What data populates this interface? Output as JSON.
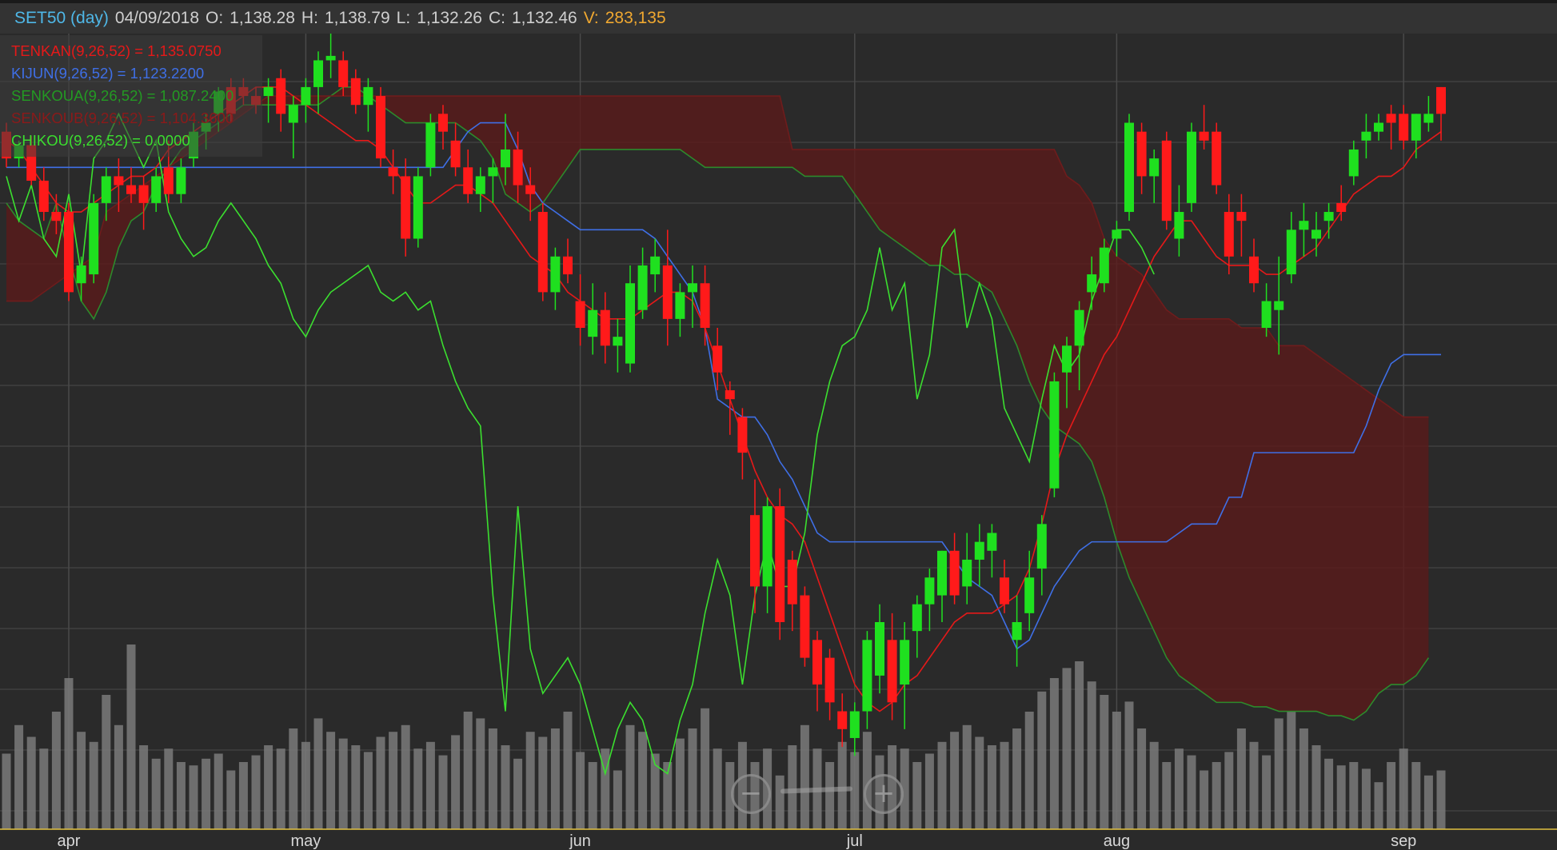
{
  "header": {
    "symbol": "SET50 (day)",
    "date": "04/09/2018",
    "open_label": "O:",
    "open": "1,138.28",
    "high_label": "H:",
    "high": "1,138.79",
    "low_label": "L:",
    "low": "1,132.26",
    "close_label": "C:",
    "close": "1,132.46",
    "volume_label": "V:",
    "volume": "283,135"
  },
  "legend": [
    {
      "text": "TENKAN(9,26,52) = 1,135.0750",
      "color": "#e51919"
    },
    {
      "text": "KIJUN(9,26,52) = 1,123.2200",
      "color": "#3f6fe6"
    },
    {
      "text": "SENKOUA(9,26,52) = 1,087.2400",
      "color": "#239a23"
    },
    {
      "text": "SENKOUB(9,26,52) = 1,104.3600",
      "color": "#8b1a1a"
    },
    {
      "text": "CHIKOU(9,26,52) = 0.0000",
      "color": "#3bdf2f"
    }
  ],
  "zoom": {
    "out_icon": "−",
    "in_icon": "+"
  },
  "colors": {
    "background": "#2a2a2a",
    "grid": "#4a4a4a",
    "up": "#1fe01f",
    "down": "#ff1a1a",
    "volume": "#7a7a7a",
    "time_axis": "#e0c040",
    "cloud_bull": "#2e6b2e",
    "cloud_bear": "#5a1a1a"
  },
  "chart_data": {
    "type": "candlestick_ichimoku",
    "x_labels": [
      {
        "label": "apr",
        "index": 5
      },
      {
        "label": "may",
        "index": 24
      },
      {
        "label": "jun",
        "index": 46
      },
      {
        "label": "jul",
        "index": 68
      },
      {
        "label": "aug",
        "index": 89
      },
      {
        "label": "sep",
        "index": 112
      }
    ],
    "candles": [
      [
        1128,
        1130,
        1120,
        1122
      ],
      [
        1122,
        1126,
        1120,
        1125
      ],
      [
        1125,
        1127,
        1116,
        1117
      ],
      [
        1117,
        1120,
        1108,
        1110
      ],
      [
        1110,
        1114,
        1105,
        1108
      ],
      [
        1110,
        1112,
        1090,
        1092
      ],
      [
        1094,
        1100,
        1090,
        1098
      ],
      [
        1096,
        1114,
        1094,
        1112
      ],
      [
        1112,
        1120,
        1108,
        1118
      ],
      [
        1118,
        1122,
        1110,
        1116
      ],
      [
        1116,
        1120,
        1112,
        1114
      ],
      [
        1116,
        1118,
        1106,
        1112
      ],
      [
        1112,
        1120,
        1110,
        1118
      ],
      [
        1120,
        1126,
        1112,
        1114
      ],
      [
        1114,
        1122,
        1112,
        1120
      ],
      [
        1122,
        1130,
        1120,
        1128
      ],
      [
        1128,
        1132,
        1124,
        1130
      ],
      [
        1132,
        1138,
        1128,
        1137
      ],
      [
        1138,
        1140,
        1130,
        1132
      ],
      [
        1138,
        1140,
        1134,
        1136
      ],
      [
        1136,
        1138,
        1132,
        1134
      ],
      [
        1136,
        1140,
        1130,
        1138
      ],
      [
        1140,
        1142,
        1128,
        1132
      ],
      [
        1130,
        1136,
        1122,
        1134
      ],
      [
        1134,
        1140,
        1130,
        1138
      ],
      [
        1138,
        1146,
        1132,
        1144
      ],
      [
        1144,
        1150,
        1140,
        1145
      ],
      [
        1144,
        1146,
        1136,
        1138
      ],
      [
        1140,
        1142,
        1132,
        1134
      ],
      [
        1134,
        1140,
        1128,
        1138
      ],
      [
        1136,
        1138,
        1120,
        1122
      ],
      [
        1120,
        1124,
        1114,
        1118
      ],
      [
        1118,
        1122,
        1100,
        1104
      ],
      [
        1104,
        1120,
        1102,
        1118
      ],
      [
        1120,
        1132,
        1118,
        1130
      ],
      [
        1132,
        1134,
        1124,
        1128
      ],
      [
        1126,
        1130,
        1118,
        1120
      ],
      [
        1120,
        1124,
        1112,
        1114
      ],
      [
        1114,
        1120,
        1110,
        1118
      ],
      [
        1118,
        1122,
        1112,
        1120
      ],
      [
        1120,
        1132,
        1116,
        1124
      ],
      [
        1124,
        1128,
        1112,
        1116
      ],
      [
        1116,
        1120,
        1108,
        1114
      ],
      [
        1110,
        1112,
        1090,
        1092
      ],
      [
        1092,
        1102,
        1088,
        1100
      ],
      [
        1100,
        1104,
        1094,
        1096
      ],
      [
        1090,
        1096,
        1080,
        1084
      ],
      [
        1082,
        1094,
        1078,
        1088
      ],
      [
        1088,
        1092,
        1076,
        1080
      ],
      [
        1080,
        1086,
        1074,
        1082
      ],
      [
        1076,
        1098,
        1074,
        1094
      ],
      [
        1088,
        1102,
        1086,
        1098
      ],
      [
        1096,
        1104,
        1092,
        1100
      ],
      [
        1098,
        1106,
        1080,
        1086
      ],
      [
        1086,
        1094,
        1082,
        1092
      ],
      [
        1092,
        1098,
        1084,
        1094
      ],
      [
        1094,
        1098,
        1080,
        1084
      ],
      [
        1080,
        1084,
        1070,
        1074
      ],
      [
        1070,
        1072,
        1060,
        1068
      ],
      [
        1064,
        1066,
        1050,
        1056
      ],
      [
        1042,
        1050,
        1020,
        1026
      ],
      [
        1026,
        1046,
        1020,
        1044
      ],
      [
        1044,
        1048,
        1014,
        1018
      ],
      [
        1032,
        1034,
        1016,
        1022
      ],
      [
        1024,
        1026,
        1008,
        1010
      ],
      [
        1014,
        1016,
        998,
        1004
      ],
      [
        1010,
        1012,
        996,
        1000
      ],
      [
        998,
        1002,
        990,
        994
      ],
      [
        992,
        1000,
        988,
        998
      ],
      [
        998,
        1016,
        994,
        1014
      ],
      [
        1006,
        1022,
        1002,
        1018
      ],
      [
        1014,
        1020,
        996,
        1000
      ],
      [
        1004,
        1018,
        994,
        1014
      ],
      [
        1016,
        1024,
        1010,
        1022
      ],
      [
        1022,
        1030,
        1016,
        1028
      ],
      [
        1024,
        1034,
        1018,
        1034
      ],
      [
        1034,
        1038,
        1022,
        1024
      ],
      [
        1026,
        1038,
        1022,
        1032
      ],
      [
        1032,
        1040,
        1026,
        1036
      ],
      [
        1034,
        1040,
        1028,
        1038
      ],
      [
        1028,
        1032,
        1020,
        1022
      ],
      [
        1014,
        1024,
        1008,
        1018
      ],
      [
        1020,
        1034,
        1016,
        1028
      ],
      [
        1030,
        1042,
        1024,
        1040
      ],
      [
        1048,
        1074,
        1046,
        1072
      ],
      [
        1074,
        1082,
        1066,
        1080
      ],
      [
        1080,
        1090,
        1070,
        1088
      ],
      [
        1092,
        1100,
        1088,
        1096
      ],
      [
        1094,
        1104,
        1092,
        1102
      ],
      [
        1104,
        1108,
        1100,
        1106
      ],
      [
        1110,
        1132,
        1108,
        1130
      ],
      [
        1128,
        1130,
        1114,
        1118
      ],
      [
        1118,
        1124,
        1112,
        1122
      ],
      [
        1126,
        1128,
        1106,
        1108
      ],
      [
        1104,
        1116,
        1100,
        1110
      ],
      [
        1112,
        1130,
        1110,
        1128
      ],
      [
        1128,
        1134,
        1124,
        1126
      ],
      [
        1128,
        1130,
        1114,
        1116
      ],
      [
        1110,
        1114,
        1096,
        1100
      ],
      [
        1110,
        1114,
        1100,
        1108
      ],
      [
        1100,
        1104,
        1092,
        1094
      ],
      [
        1084,
        1094,
        1082,
        1090
      ],
      [
        1088,
        1100,
        1078,
        1090
      ],
      [
        1096,
        1110,
        1094,
        1106
      ],
      [
        1106,
        1112,
        1100,
        1108
      ],
      [
        1104,
        1110,
        1100,
        1106
      ],
      [
        1108,
        1112,
        1104,
        1110
      ],
      [
        1112,
        1116,
        1108,
        1110
      ],
      [
        1118,
        1126,
        1116,
        1124
      ],
      [
        1126,
        1132,
        1122,
        1128
      ],
      [
        1128,
        1132,
        1126,
        1130
      ],
      [
        1132,
        1134,
        1124,
        1130
      ],
      [
        1132,
        1134,
        1124,
        1126
      ],
      [
        1126,
        1132,
        1122,
        1132
      ],
      [
        1130,
        1136,
        1128,
        1132
      ],
      [
        1138,
        1138,
        1126,
        1132
      ]
    ],
    "volume": [],
    "tenkan": [
      1126,
      1124,
      1120,
      1116,
      1112,
      1110,
      1110,
      1112,
      1114,
      1116,
      1118,
      1118,
      1120,
      1124,
      1126,
      1128,
      1130,
      1132,
      1134,
      1136,
      1138,
      1138,
      1138,
      1136,
      1134,
      1132,
      1130,
      1128,
      1126,
      1126,
      1124,
      1120,
      1116,
      1112,
      1112,
      1114,
      1116,
      1116,
      1114,
      1112,
      1108,
      1104,
      1100,
      1098,
      1096,
      1092,
      1090,
      1088,
      1086,
      1086,
      1086,
      1088,
      1090,
      1092,
      1092,
      1090,
      1084,
      1076,
      1068,
      1060,
      1052,
      1046,
      1042,
      1040,
      1036,
      1028,
      1020,
      1012,
      1004,
      1000,
      998,
      1000,
      1004,
      1006,
      1010,
      1014,
      1018,
      1020,
      1020,
      1020,
      1022,
      1024,
      1030,
      1040,
      1052,
      1060,
      1066,
      1072,
      1078,
      1082,
      1088,
      1094,
      1100,
      1104,
      1108,
      1108,
      1104,
      1100,
      1098,
      1098,
      1098,
      1096,
      1096,
      1098,
      1100,
      1102,
      1106,
      1110,
      1114,
      1116,
      1118,
      1118,
      1120,
      1124,
      1126,
      1128
    ],
    "kijun": [
      1120,
      1120,
      1120,
      1120,
      1120,
      1120,
      1120,
      1120,
      1120,
      1120,
      1120,
      1120,
      1120,
      1120,
      1120,
      1120,
      1120,
      1120,
      1120,
      1120,
      1120,
      1120,
      1120,
      1120,
      1120,
      1120,
      1120,
      1120,
      1120,
      1120,
      1120,
      1120,
      1120,
      1120,
      1120,
      1120,
      1124,
      1128,
      1130,
      1130,
      1130,
      1124,
      1116,
      1112,
      1110,
      1108,
      1106,
      1106,
      1106,
      1106,
      1106,
      1106,
      1104,
      1100,
      1096,
      1092,
      1084,
      1068,
      1066,
      1064,
      1064,
      1060,
      1054,
      1050,
      1044,
      1038,
      1036,
      1036,
      1036,
      1036,
      1036,
      1036,
      1036,
      1036,
      1036,
      1036,
      1032,
      1028,
      1026,
      1024,
      1018,
      1012,
      1014,
      1020,
      1026,
      1030,
      1034,
      1036,
      1036,
      1036,
      1036,
      1036,
      1036,
      1036,
      1038,
      1040,
      1040,
      1040,
      1046,
      1046,
      1056,
      1056,
      1056,
      1056,
      1056,
      1056,
      1056,
      1056,
      1056,
      1062,
      1070,
      1076,
      1078,
      1078,
      1078,
      1078
    ],
    "senkou_a": [
      1112,
      1108,
      1106,
      1104,
      1112,
      1100,
      1090,
      1086,
      1092,
      1102,
      1108,
      1110,
      1116,
      1120,
      1124,
      1126,
      1128,
      1130,
      1132,
      1134,
      1134,
      1134,
      1134,
      1134,
      1134,
      1134,
      1136,
      1138,
      1138,
      1136,
      1134,
      1132,
      1130,
      1130,
      1130,
      1130,
      1130,
      1128,
      1126,
      1122,
      1114,
      1112,
      1110,
      1112,
      1116,
      1120,
      1124,
      1124,
      1124,
      1124,
      1124,
      1124,
      1124,
      1124,
      1124,
      1122,
      1120,
      1120,
      1120,
      1120,
      1120,
      1120,
      1120,
      1120,
      1118,
      1118,
      1118,
      1118,
      1114,
      1110,
      1106,
      1104,
      1102,
      1100,
      1098,
      1098,
      1096,
      1096,
      1094,
      1092,
      1086,
      1080,
      1072,
      1066,
      1062,
      1060,
      1058,
      1054,
      1046,
      1036,
      1028,
      1022,
      1016,
      1010,
      1006,
      1004,
      1002,
      1000,
      1000,
      1000,
      999,
      999,
      998,
      998,
      998,
      998,
      997,
      997,
      996,
      998,
      1002,
      1004,
      1004,
      1006,
      1010
    ],
    "senkou_b": [
      1090,
      1090,
      1090,
      1092,
      1094,
      1096,
      1098,
      1100,
      1110,
      1112,
      1114,
      1116,
      1118,
      1120,
      1122,
      1124,
      1126,
      1128,
      1130,
      1132,
      1134,
      1136,
      1136,
      1136,
      1136,
      1136,
      1136,
      1136,
      1136,
      1136,
      1136,
      1136,
      1136,
      1136,
      1136,
      1136,
      1136,
      1136,
      1136,
      1136,
      1136,
      1136,
      1136,
      1136,
      1136,
      1136,
      1136,
      1136,
      1136,
      1136,
      1136,
      1136,
      1136,
      1136,
      1136,
      1136,
      1136,
      1136,
      1136,
      1136,
      1136,
      1136,
      1136,
      1124,
      1124,
      1124,
      1124,
      1124,
      1124,
      1124,
      1124,
      1124,
      1124,
      1124,
      1124,
      1124,
      1124,
      1124,
      1124,
      1124,
      1124,
      1124,
      1124,
      1124,
      1124,
      1118,
      1116,
      1112,
      1104,
      1100,
      1098,
      1096,
      1092,
      1088,
      1086,
      1086,
      1086,
      1086,
      1086,
      1084,
      1084,
      1084,
      1080,
      1080,
      1080,
      1078,
      1076,
      1074,
      1072,
      1070,
      1068,
      1066,
      1064,
      1064,
      1064
    ],
    "chikou": [
      1118,
      1108,
      1116,
      1104,
      1100,
      1114,
      1096,
      1122,
      1126,
      1132,
      1126,
      1120,
      1126,
      1110,
      1104,
      1100,
      1102,
      1108,
      1112,
      1108,
      1104,
      1098,
      1094,
      1086,
      1082,
      1088,
      1092,
      1094,
      1096,
      1098,
      1092,
      1090,
      1092,
      1088,
      1090,
      1080,
      1072,
      1066,
      1062,
      1024,
      998,
      1044,
      1012,
      1002,
      1006,
      1010,
      1004,
      994,
      984,
      994,
      1000,
      996,
      986,
      984,
      996,
      1004,
      1020,
      1032,
      1024,
      1004,
      1024,
      1036,
      1026,
      1026,
      1038,
      1060,
      1072,
      1080,
      1082,
      1088,
      1102,
      1088,
      1094,
      1068,
      1078,
      1102,
      1106,
      1084,
      1094,
      1086,
      1066,
      1060,
      1054,
      1068,
      1080,
      1074,
      1078,
      1090,
      1098,
      1106,
      1106,
      1102,
      1096
    ],
    "price_range": [
      985,
      1150
    ]
  }
}
